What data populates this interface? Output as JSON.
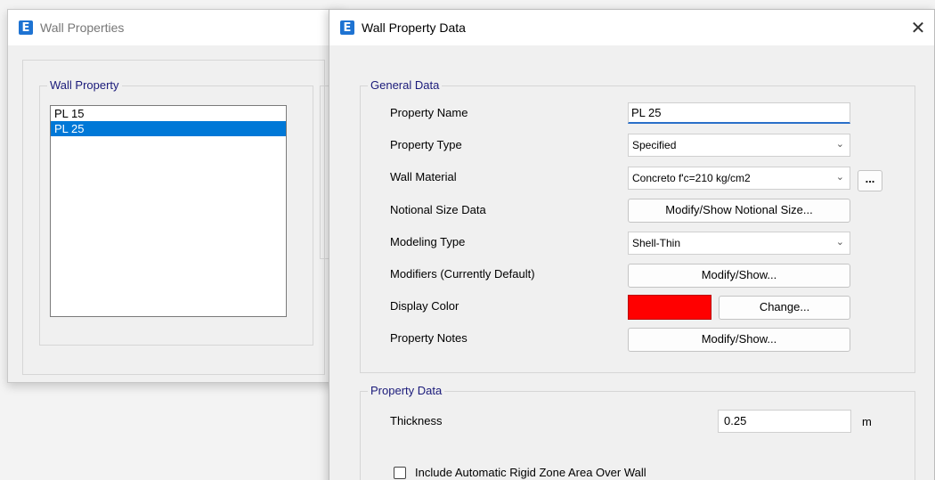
{
  "back_window": {
    "title": "Wall Properties",
    "group_label": "Wall Property",
    "list": [
      "PL 15",
      "PL 25"
    ],
    "selected_index": 1
  },
  "front_window": {
    "title": "Wall Property Data",
    "close_glyph": "✕",
    "general": {
      "legend": "General Data",
      "property_name_label": "Property Name",
      "property_name_value": "PL 25",
      "property_type_label": "Property Type",
      "property_type_value": "Specified",
      "wall_material_label": "Wall Material",
      "wall_material_value": "Concreto f'c=210 kg/cm2",
      "material_more_button": "...",
      "notional_label": "Notional Size Data",
      "notional_button": "Modify/Show Notional Size...",
      "modeling_type_label": "Modeling Type",
      "modeling_type_value": "Shell-Thin",
      "modifiers_label": "Modifiers (Currently Default)",
      "modifiers_button": "Modify/Show...",
      "display_color_label": "Display Color",
      "display_color_hex": "#ff0000",
      "change_button": "Change...",
      "notes_label": "Property Notes",
      "notes_button": "Modify/Show..."
    },
    "property_data": {
      "legend": "Property Data",
      "thickness_label": "Thickness",
      "thickness_value": "0.25",
      "thickness_unit": "m",
      "rigid_zone_label": "Include Automatic Rigid Zone Area Over Wall",
      "rigid_zone_checked": false
    }
  }
}
